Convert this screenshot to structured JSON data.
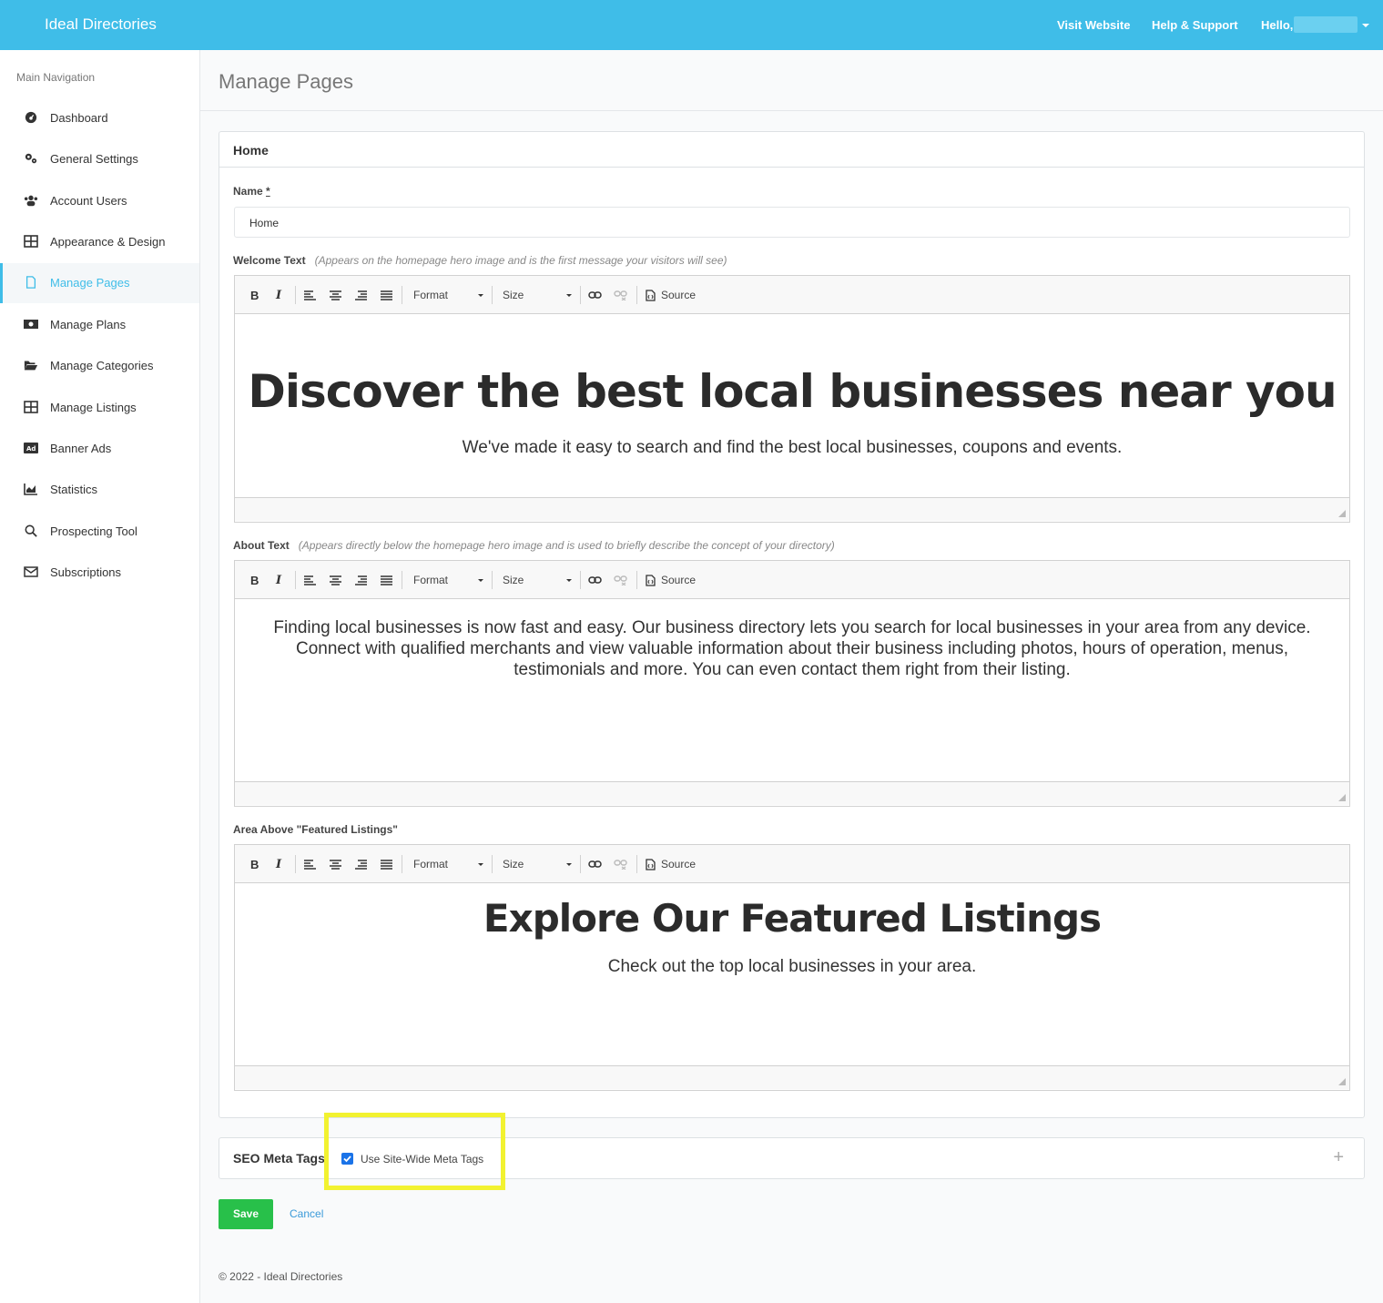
{
  "topbar": {
    "brand": "Ideal Directories",
    "visit_website": "Visit Website",
    "help_support": "Help & Support",
    "hello": "Hello,"
  },
  "sidebar": {
    "heading": "Main Navigation",
    "items": [
      {
        "label": "Dashboard",
        "icon": "dashboard-icon"
      },
      {
        "label": "General Settings",
        "icon": "gears-icon"
      },
      {
        "label": "Account Users",
        "icon": "users-icon"
      },
      {
        "label": "Appearance & Design",
        "icon": "grid-icon"
      },
      {
        "label": "Manage Pages",
        "icon": "file-icon",
        "active": true
      },
      {
        "label": "Manage Plans",
        "icon": "money-icon"
      },
      {
        "label": "Manage Categories",
        "icon": "folder-open-icon"
      },
      {
        "label": "Manage Listings",
        "icon": "grid-icon"
      },
      {
        "label": "Banner Ads",
        "icon": "ad-icon"
      },
      {
        "label": "Statistics",
        "icon": "chart-icon"
      },
      {
        "label": "Prospecting Tool",
        "icon": "search-icon"
      },
      {
        "label": "Subscriptions",
        "icon": "envelope-icon"
      }
    ]
  },
  "page": {
    "title": "Manage Pages"
  },
  "card": {
    "title": "Home",
    "name_label": "Name",
    "name_required": "*",
    "name_value": "Home",
    "welcome_label": "Welcome Text",
    "welcome_hint": "(Appears on the homepage hero image and is the first message your visitors will see)",
    "about_label": "About Text",
    "about_hint": "(Appears directly below the homepage hero image and is used to briefly describe the concept of your directory)",
    "featured_label": "Area Above \"Featured Listings\""
  },
  "toolbar": {
    "bold": "B",
    "italic": "I",
    "format": "Format",
    "size": "Size",
    "source": "Source"
  },
  "editors": {
    "welcome_heading": "Discover the best local businesses near you",
    "welcome_sub": "We've made it easy to search and find the best local businesses, coupons and events.",
    "about_text": "Finding local businesses is now fast and easy. Our business directory lets you search for local businesses in your area from any device. Connect with qualified merchants and view valuable information about their business including photos, hours of operation, menus, testimonials and more. You can even contact them right from their listing.",
    "featured_heading": "Explore Our Featured Listings",
    "featured_sub": "Check out the top local businesses in your area."
  },
  "seo": {
    "title": "SEO Meta Tags",
    "checkbox_label": "Use Site-Wide Meta Tags",
    "checked": true,
    "expand": "+"
  },
  "actions": {
    "save": "Save",
    "cancel": "Cancel"
  },
  "footer": {
    "text": "© 2022 - Ideal Directories"
  },
  "colors": {
    "topbar": "#3fbde8",
    "save": "#28c04a",
    "highlight": "#f2f230"
  }
}
